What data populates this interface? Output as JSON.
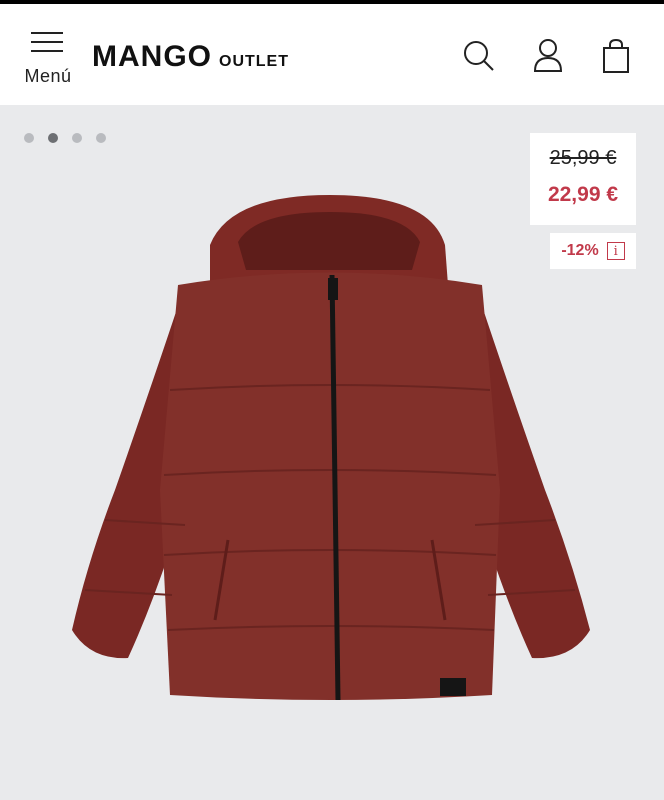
{
  "header": {
    "menu_label": "Menú",
    "brand_name": "MANGO",
    "brand_suffix": "OUTLET",
    "icons": [
      "search-icon",
      "user-icon",
      "bag-icon"
    ]
  },
  "gallery": {
    "dots": [
      {
        "active": false
      },
      {
        "active": true
      },
      {
        "active": false
      },
      {
        "active": false
      }
    ]
  },
  "price": {
    "original": "25,99 €",
    "current": "22,99 €",
    "discount": "-12%",
    "info_icon_label": "i"
  },
  "colors": {
    "sale_red": "#c1394a",
    "background": "#e9eaec",
    "jacket": "#7f2a25"
  }
}
